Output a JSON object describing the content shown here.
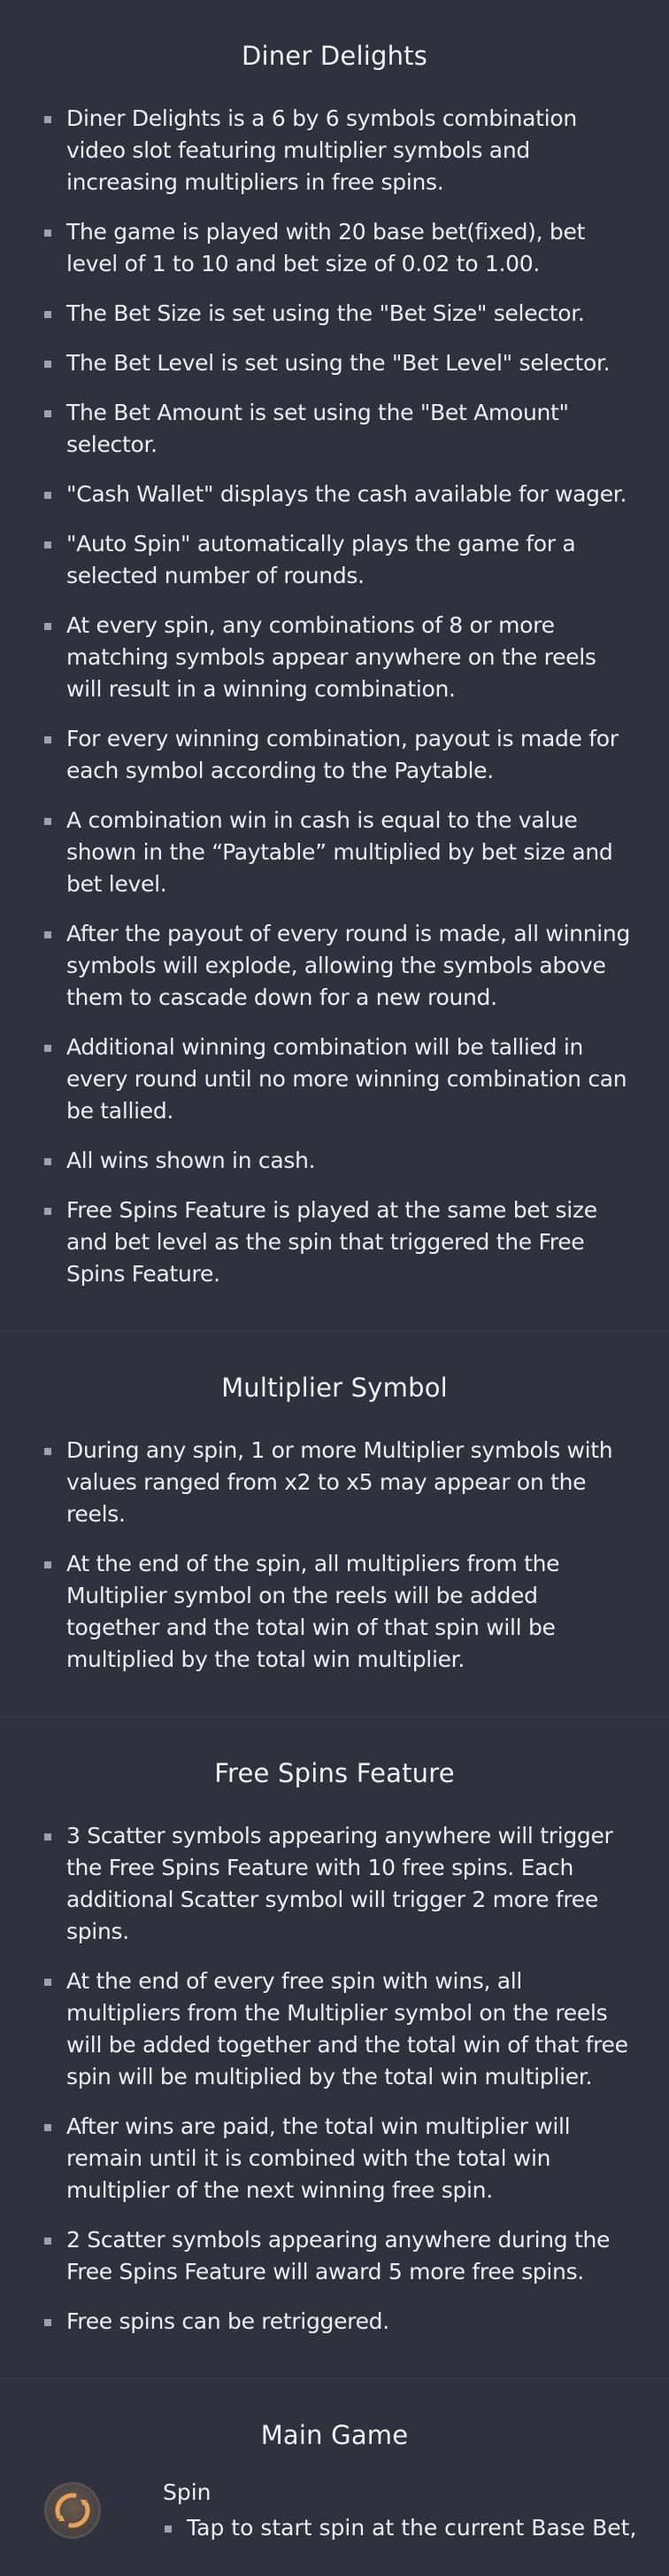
{
  "sections": [
    {
      "title": "Diner Delights",
      "items": [
        "Diner Delights is a 6 by 6 symbols combination video slot featuring multiplier symbols and increasing multipliers in free spins.",
        "The game is played with 20 base bet(fixed), bet level of 1 to 10 and bet size of 0.02 to 1.00.",
        "The Bet Size is set using the \"Bet Size\" selector.",
        "The Bet Level is set using the \"Bet Level\" selector.",
        "The Bet Amount is set using the \"Bet Amount\" selector.",
        "\"Cash Wallet\" displays the cash available for wager.",
        "\"Auto Spin\" automatically plays the game for a selected number of rounds.",
        "At every spin, any combinations of 8 or more matching symbols appear anywhere on the reels will result in a winning combination.",
        "For every winning combination, payout is made for each symbol according to the Paytable.",
        "A combination win in cash is equal to the value shown in the “Paytable” multiplied by bet size and bet level.",
        "After the payout of every round is made, all winning symbols will explode, allowing the symbols above them to cascade down for a new round.",
        "Additional winning combination will be tallied in every round until no more winning combination can be tallied.",
        "All wins shown in cash.",
        "Free Spins Feature is played at the same bet size and bet level as the spin that triggered the Free Spins Feature."
      ]
    },
    {
      "title": "Multiplier Symbol",
      "items": [
        "During any spin, 1 or more Multiplier symbols with values ranged from x2 to x5 may appear on the reels.",
        "At the end of the spin, all multipliers from the Multiplier symbol on the reels will be added together and the total win of that spin will be multiplied by the total win multiplier."
      ]
    },
    {
      "title": "Free Spins Feature",
      "items": [
        "3 Scatter symbols appearing anywhere will trigger the Free Spins Feature with 10 free spins. Each additional Scatter symbol will trigger 2 more free spins.",
        "At the end of every free spin with wins, all multipliers from the Multiplier symbol on the reels will be added together and the total win of that free spin will be multiplied by the total win multiplier.",
        "After wins are paid, the total win multiplier will remain until it is combined with the total win multiplier of the next winning free spin.",
        "2 Scatter symbols appearing anywhere during the Free Spins Feature will award 5 more free spins.",
        "Free spins can be retriggered."
      ]
    }
  ],
  "main_game": {
    "title": "Main Game",
    "spin_label": "Spin",
    "spin_icon": "spin-icon",
    "spin_desc": "Tap to start spin at the current Base Bet,"
  },
  "colors": {
    "background": "#30313e",
    "text": "#eceef6",
    "bullet": "#9fa1af",
    "icon_accent": "#e8a25a"
  }
}
